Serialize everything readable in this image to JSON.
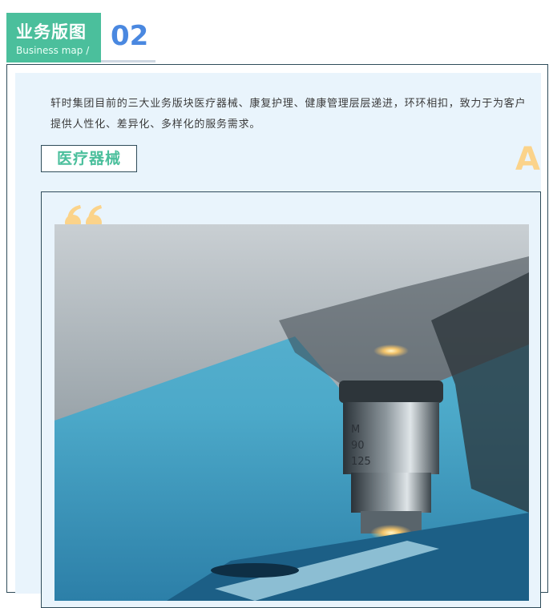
{
  "header": {
    "title": "业务版图",
    "subtitle": "Business map /",
    "number": "02"
  },
  "intro": {
    "text": "轩时集团目前的三大业务版块医疗器械、康复护理、健康管理层层递进，环环相扣，致力于为客户提供人性化、差异化、多样化的服务需求。"
  },
  "section": {
    "title": "医疗器械",
    "letter": "A"
  },
  "card": {
    "quote_icon": "quote-mark-icon",
    "image": "microscope-photo"
  },
  "colors": {
    "accent_green": "#4bbf9c",
    "number_blue": "#4a88e0",
    "highlight_yellow": "#fbd38a",
    "panel_bg": "#e9f4fc",
    "border_dark": "#2f4c5a"
  }
}
